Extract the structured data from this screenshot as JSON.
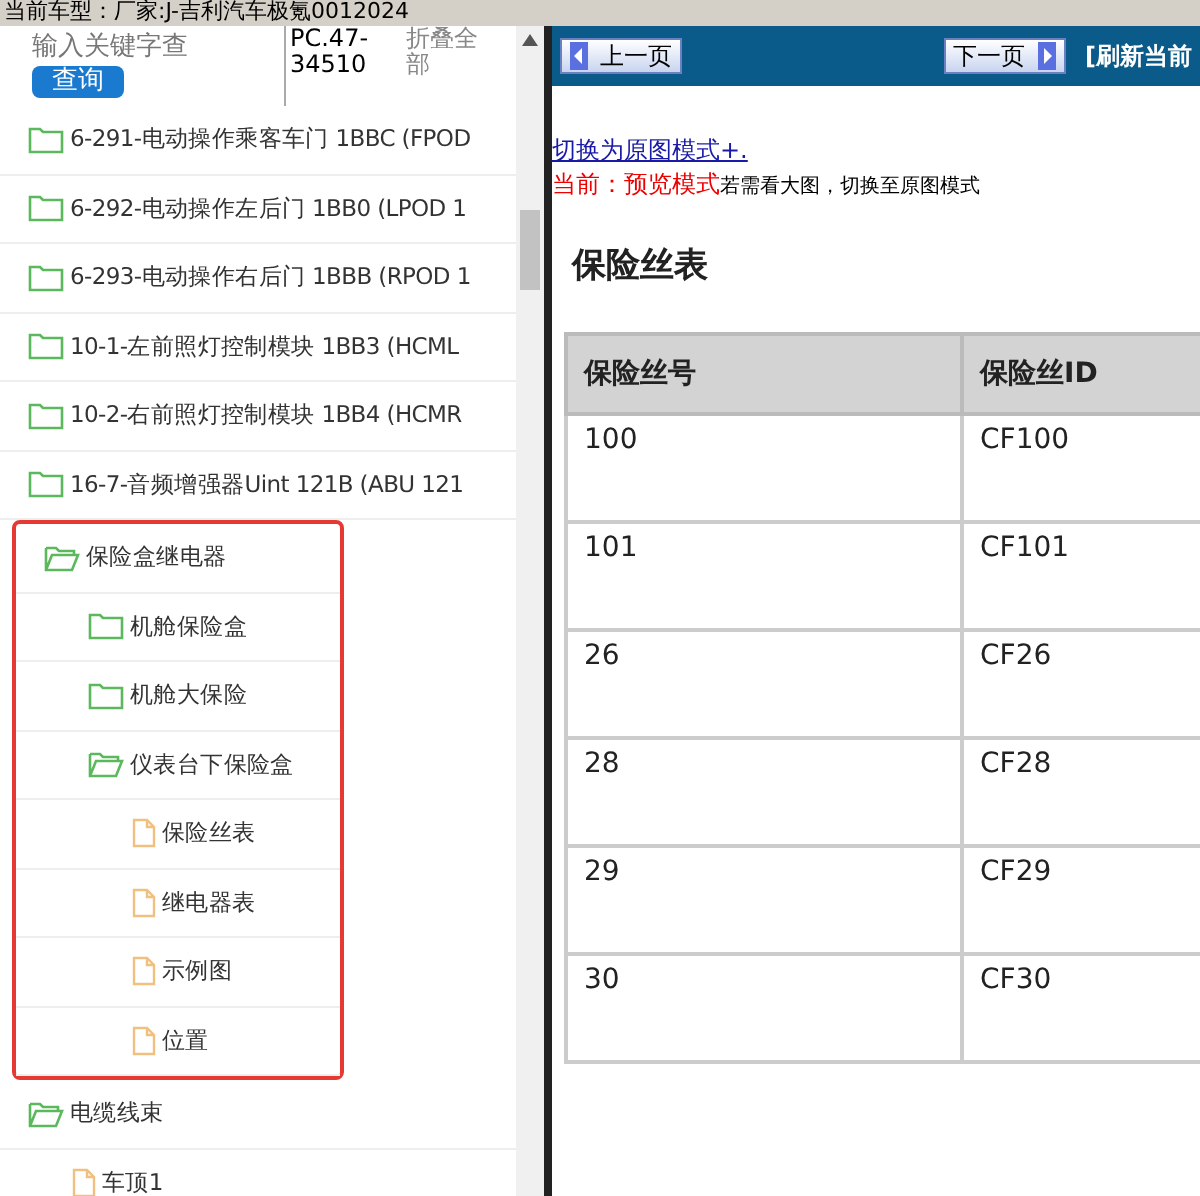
{
  "vehicle_bar": {
    "text": "当前车型：厂家:J-吉利汽车极氪0012024"
  },
  "search": {
    "placeholder": "输入关键字查",
    "button": "查询",
    "code": "PC.47-34510",
    "collapse_all": "折叠全部"
  },
  "tree": [
    {
      "label": "6-291-电动操作乘客车门 1BBC (FPOD",
      "kind": "folder",
      "expanded": false
    },
    {
      "label": "6-292-电动操作左后门 1BB0 (LPOD 1",
      "kind": "folder",
      "expanded": false
    },
    {
      "label": "6-293-电动操作右后门 1BBB (RPOD 1",
      "kind": "folder",
      "expanded": false
    },
    {
      "label": "10-1-左前照灯控制模块 1BB3 (HCML",
      "kind": "folder",
      "expanded": false
    },
    {
      "label": "10-2-右前照灯控制模块 1BB4 (HCMR",
      "kind": "folder",
      "expanded": false
    },
    {
      "label": "16-7-音频增强器Uint 121B (ABU 121",
      "kind": "folder",
      "expanded": false
    },
    {
      "label": "保险盒继电器",
      "kind": "folder",
      "expanded": true,
      "highlighted": true,
      "children": [
        {
          "label": "机舱保险盒",
          "kind": "folder",
          "expanded": false
        },
        {
          "label": "机舱大保险",
          "kind": "folder",
          "expanded": false
        },
        {
          "label": "仪表台下保险盒",
          "kind": "folder",
          "expanded": true,
          "children": [
            {
              "label": "保险丝表",
              "kind": "file"
            },
            {
              "label": "继电器表",
              "kind": "file"
            },
            {
              "label": "示例图",
              "kind": "file"
            },
            {
              "label": "位置",
              "kind": "file"
            }
          ]
        }
      ]
    },
    {
      "label": "电缆线束",
      "kind": "folder",
      "expanded": true,
      "children": [
        {
          "label": "车顶1",
          "kind": "file"
        }
      ]
    }
  ],
  "nav": {
    "prev": "上一页",
    "next": "下一页",
    "refresh": "[刷新当前"
  },
  "mode": {
    "link": "切换为原图模式+.",
    "current": "当前：预览模式",
    "hint": "若需看大图，切换至原图模式"
  },
  "content": {
    "title": "保险丝表",
    "columns": [
      "保险丝号",
      "保险丝ID"
    ],
    "rows": [
      [
        "100",
        "CF100"
      ],
      [
        "101",
        "CF101"
      ],
      [
        "26",
        "CF26"
      ],
      [
        "28",
        "CF28"
      ],
      [
        "29",
        "CF29"
      ],
      [
        "30",
        "CF30"
      ]
    ]
  }
}
